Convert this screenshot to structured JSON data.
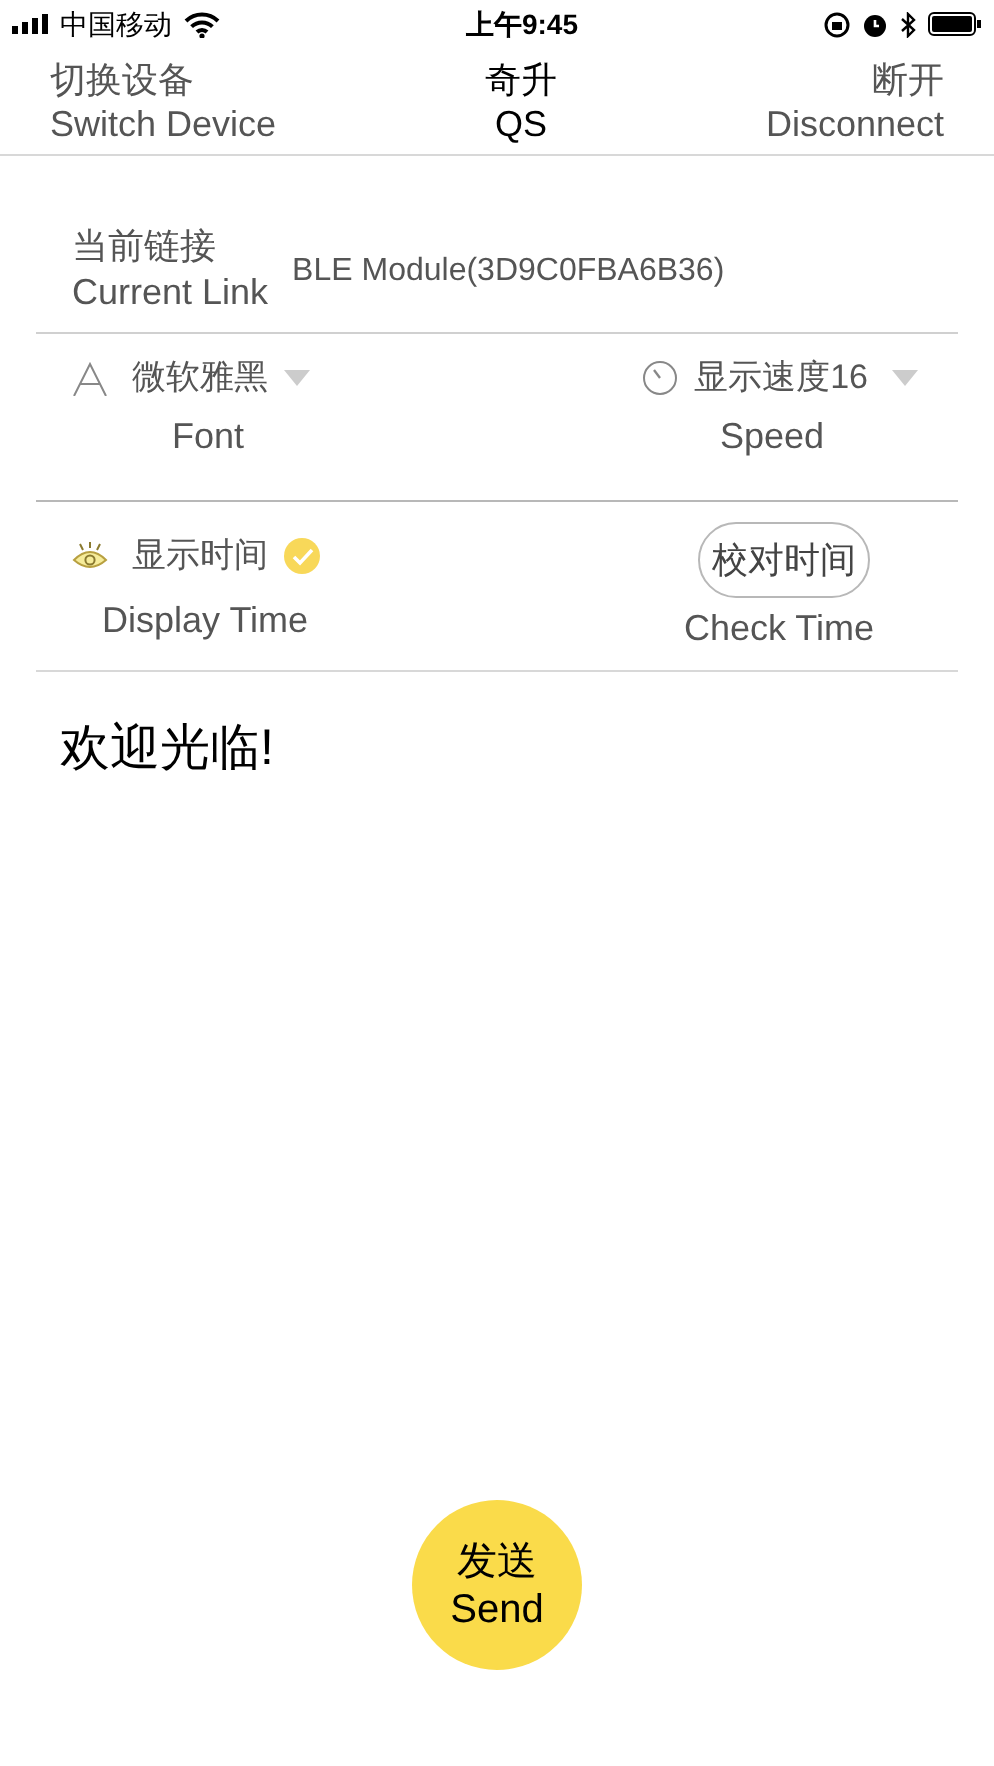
{
  "status_bar": {
    "carrier": "中国移动",
    "time": "上午9:45"
  },
  "nav": {
    "left": {
      "zh": "切换设备",
      "en": "Switch Device"
    },
    "title": {
      "zh": "奇升",
      "en": "QS"
    },
    "right": {
      "zh": "断开",
      "en": "Disconnect"
    }
  },
  "current_link": {
    "zh": "当前链接",
    "en": "Current Link",
    "value": "BLE Module(3D9C0FBA6B36)"
  },
  "font": {
    "value": "微软雅黑",
    "label": "Font"
  },
  "speed": {
    "value": "显示速度16",
    "label": "Speed"
  },
  "display_time": {
    "zh": "显示时间",
    "en": "Display Time",
    "checked": true
  },
  "check_time": {
    "button": "校对时间",
    "label": "Check Time"
  },
  "message": "欢迎光临!",
  "send": {
    "zh": "发送",
    "en": "Send"
  }
}
